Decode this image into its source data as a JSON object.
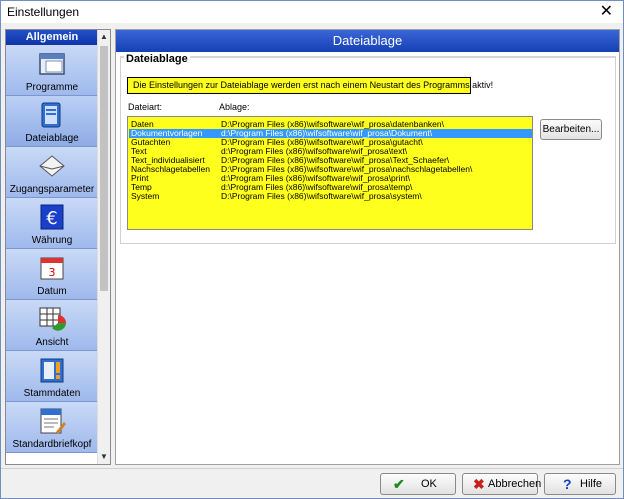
{
  "window": {
    "title": "Einstellungen",
    "close_glyph": "✕"
  },
  "sidebar": {
    "header": "Allgemein",
    "items": [
      {
        "label": "Programme",
        "icon": "window-icon"
      },
      {
        "label": "Dateiablage",
        "icon": "folder-book-icon"
      },
      {
        "label": "Zugangsparameter",
        "icon": "envelope-icon"
      },
      {
        "label": "Währung",
        "icon": "euro-icon"
      },
      {
        "label": "Datum",
        "icon": "calendar-icon"
      },
      {
        "label": "Ansicht",
        "icon": "table-chart-icon"
      },
      {
        "label": "Stammdaten",
        "icon": "folder-alert-icon"
      },
      {
        "label": "Standardbriefkopf",
        "icon": "letterhead-icon"
      }
    ],
    "scroll_up": "▲",
    "scroll_down": "▼"
  },
  "main": {
    "header": "Dateiablage",
    "group_title": "Dateiablage",
    "notice": "Die Einstellungen zur Dateiablage werden erst nach einem Neustart des Programms aktiv!",
    "col_type": "Dateiart:",
    "col_path": "Ablage:",
    "rows": [
      {
        "type": "Daten",
        "path": "D:\\Program Files (x86)\\wifsoftware\\wif_prosa\\datenbanken\\"
      },
      {
        "type": "Dokumentvorlagen",
        "path": "d:\\Program Files (x86)\\wifsoftware\\wif_prosa\\Dokument\\"
      },
      {
        "type": "Gutachten",
        "path": "D:\\Program Files (x86)\\wifsoftware\\wif_prosa\\gutacht\\"
      },
      {
        "type": "Text",
        "path": "d:\\Program Files (x86)\\wifsoftware\\wif_prosa\\text\\"
      },
      {
        "type": "Text_individualisiert",
        "path": "D:\\Program Files (x86)\\wifsoftware\\wif_prosa\\Text_Schaefer\\"
      },
      {
        "type": "Nachschlagetabellen",
        "path": "D:\\Program Files (x86)\\wifsoftware\\wif_prosa\\nachschlagetabellen\\"
      },
      {
        "type": "Print",
        "path": "d:\\Program Files (x86)\\wifsoftware\\wif_prosa\\print\\"
      },
      {
        "type": "Temp",
        "path": "d:\\Program Files (x86)\\wifsoftware\\wif_prosa\\temp\\"
      },
      {
        "type": "System",
        "path": "D:\\Program Files (x86)\\wifsoftware\\wif_prosa\\system\\"
      }
    ],
    "selected_row": 1,
    "edit_button": "Bearbeiten..."
  },
  "footer": {
    "ok": "OK",
    "cancel": "Abbrechen",
    "help": "Hilfe"
  },
  "colors": {
    "header_blue": "#1540b4",
    "highlight_yellow": "#ffff1e",
    "selection_blue": "#3399ff",
    "ok_green": "#1c8a1c",
    "cancel_red": "#c81e1e",
    "help_blue": "#1c3cc8"
  }
}
